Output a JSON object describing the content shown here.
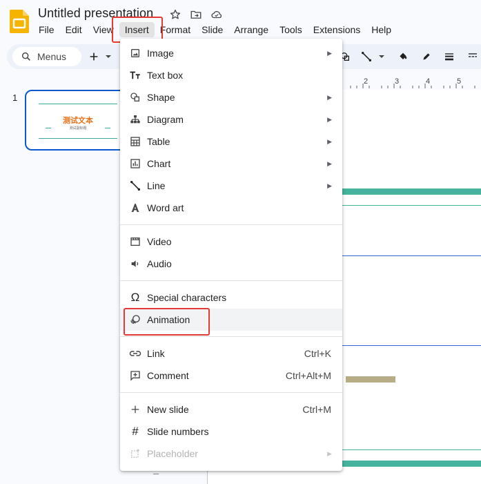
{
  "header": {
    "title": "Untitled presentation",
    "icons": [
      "star-icon",
      "move-to-folder-icon",
      "cloud-saved-icon"
    ]
  },
  "menubar": {
    "items": [
      "File",
      "Edit",
      "View",
      "Insert",
      "Format",
      "Slide",
      "Arrange",
      "Tools",
      "Extensions",
      "Help"
    ],
    "active": "Insert"
  },
  "toolbar": {
    "search_label": "Menus",
    "icons": [
      "search-icon",
      "add-icon",
      "dropdown-arrow-icon",
      "shape-icon",
      "line-icon",
      "dropdown-arrow-icon",
      "fill-color-icon",
      "border-color-icon",
      "border-weight-icon",
      "border-dash-icon"
    ]
  },
  "slides_panel": {
    "slide_number": "1",
    "thumb_title": "测试文本",
    "thumb_subtitle": "测试副标题"
  },
  "ruler": {
    "labels": [
      "2",
      "3",
      "4",
      "5"
    ]
  },
  "insert_menu": {
    "groups": [
      [
        {
          "label": "Image",
          "icon": "image-icon",
          "submenu": true
        },
        {
          "label": "Text box",
          "icon": "text-box-icon",
          "submenu": false
        },
        {
          "label": "Shape",
          "icon": "shape-icon",
          "submenu": true
        },
        {
          "label": "Diagram",
          "icon": "diagram-icon",
          "submenu": true
        },
        {
          "label": "Table",
          "icon": "table-icon",
          "submenu": true
        },
        {
          "label": "Chart",
          "icon": "chart-icon",
          "submenu": true
        },
        {
          "label": "Line",
          "icon": "line-icon",
          "submenu": true
        },
        {
          "label": "Word art",
          "icon": "word-art-icon",
          "submenu": false
        }
      ],
      [
        {
          "label": "Video",
          "icon": "video-icon",
          "submenu": false
        },
        {
          "label": "Audio",
          "icon": "audio-icon",
          "submenu": false
        }
      ],
      [
        {
          "label": "Special characters",
          "icon": "omega-icon",
          "submenu": false
        },
        {
          "label": "Animation",
          "icon": "animation-icon",
          "submenu": false,
          "hovered": true
        }
      ],
      [
        {
          "label": "Link",
          "icon": "link-icon",
          "shortcut": "Ctrl+K"
        },
        {
          "label": "Comment",
          "icon": "comment-icon",
          "shortcut": "Ctrl+Alt+M"
        }
      ],
      [
        {
          "label": "New slide",
          "icon": "plus-icon",
          "shortcut": "Ctrl+M"
        },
        {
          "label": "Slide numbers",
          "icon": "hash-icon"
        },
        {
          "label": "Placeholder",
          "icon": "placeholder-icon",
          "submenu": true,
          "disabled": true
        }
      ]
    ]
  },
  "colors": {
    "accent_blue": "#0b57d0",
    "highlight_red": "#e53935",
    "slide_teal": "#45b39d",
    "slide_orange": "#e8711a",
    "slide_tan": "#b6ac85"
  }
}
